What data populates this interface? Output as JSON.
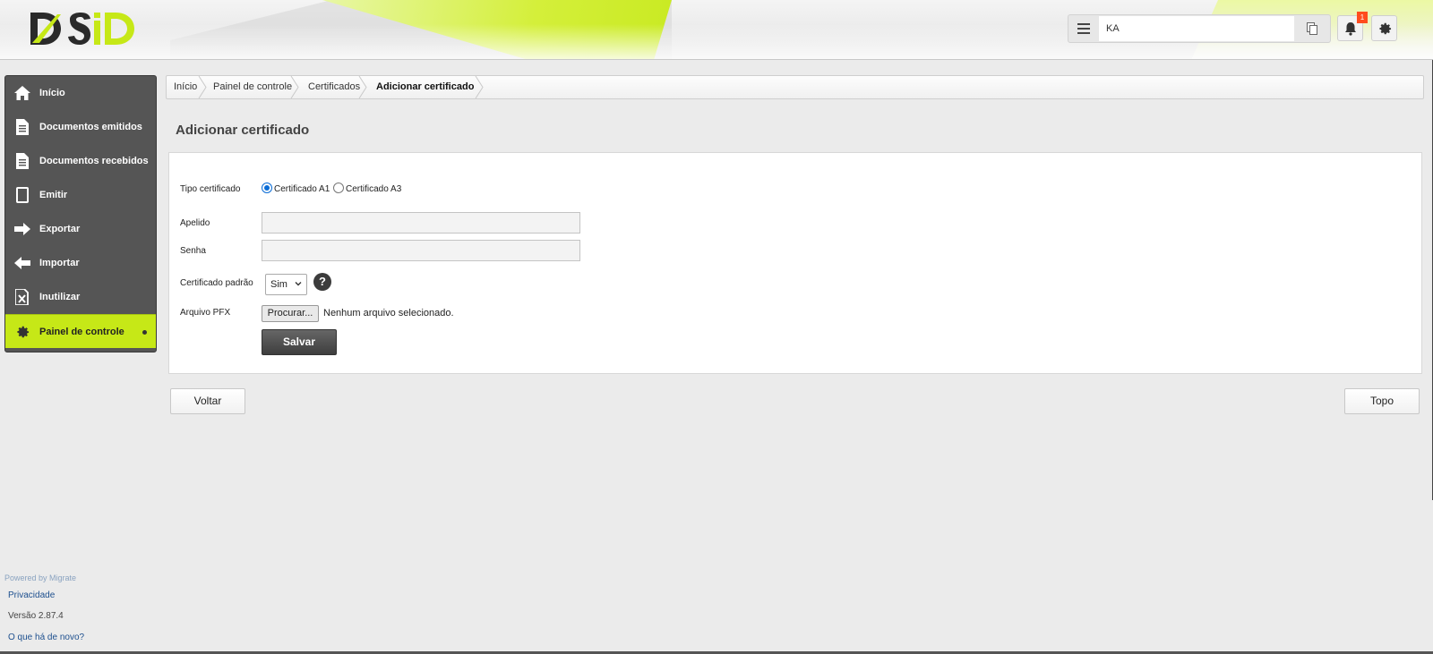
{
  "header": {
    "search_value": "KA",
    "notification_count": "1"
  },
  "sidebar": {
    "items": [
      {
        "label": "Início",
        "icon": "home-icon"
      },
      {
        "label": "Documentos emitidos",
        "icon": "document-icon"
      },
      {
        "label": "Documentos recebidos",
        "icon": "document-icon"
      },
      {
        "label": "Emitir",
        "icon": "tablet-icon"
      },
      {
        "label": "Exportar",
        "icon": "arrow-right-icon"
      },
      {
        "label": "Importar",
        "icon": "arrow-left-icon"
      },
      {
        "label": "Inutilizar",
        "icon": "cancel-document-icon"
      },
      {
        "label": "Painel de controle",
        "icon": "gear-icon",
        "active": true
      }
    ],
    "active_color": "#c6e817"
  },
  "breadcrumb": {
    "items": [
      "Início",
      "Painel de controle",
      "Certificados",
      "Adicionar certificado"
    ]
  },
  "page": {
    "title": "Adicionar certificado"
  },
  "form": {
    "tipo_label": "Tipo certificado",
    "tipo_options": [
      "Certificado A1",
      "Certificado A3"
    ],
    "tipo_selected": "Certificado A1",
    "apelido_label": "Apelido",
    "apelido_value": "",
    "senha_label": "Senha",
    "senha_value": "",
    "padrao_label": "Certificado padrão",
    "padrao_value": "Sim",
    "help_symbol": "?",
    "arquivo_label": "Arquivo PFX",
    "browse_label": "Procurar...",
    "file_status": "Nenhum arquivo selecionado.",
    "save_label": "Salvar"
  },
  "actions": {
    "back_label": "Voltar",
    "top_label": "Topo"
  },
  "footer": {
    "powered": "Powered by Migrate",
    "privacy": "Privacidade",
    "version": "Versão 2.87.4",
    "whats_new": "O que há de novo?"
  }
}
